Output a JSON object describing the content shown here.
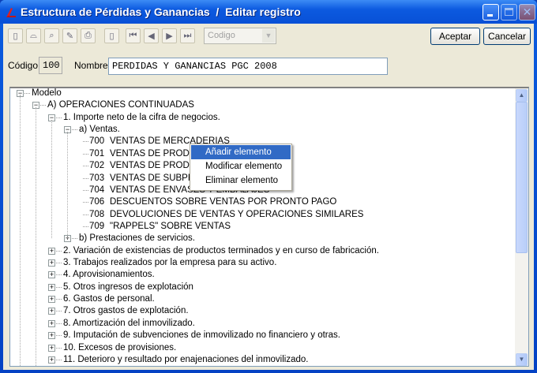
{
  "window": {
    "title": "Estructura de Pérdidas y Ganancias  /  Editar registro"
  },
  "toolbar": {
    "icons": [
      "new-icon",
      "open-icon",
      "search-icon",
      "edit-icon",
      "print-icon",
      "copy-icon",
      "first-icon",
      "prev-icon",
      "next-icon",
      "last-icon"
    ],
    "order_combo": "Codigo",
    "accept_label": "Aceptar",
    "cancel_label": "Cancelar"
  },
  "form": {
    "codigo_label": "Código",
    "codigo_value": "100",
    "nombre_label": "Nombre",
    "nombre_value": "PERDIDAS Y GANANCIAS PGC 2008"
  },
  "tree": [
    {
      "level": 0,
      "toggle": "-",
      "label": "Modelo"
    },
    {
      "level": 1,
      "toggle": "-",
      "label": "A) OPERACIONES CONTINUADAS"
    },
    {
      "level": 2,
      "toggle": "-",
      "label": "1. Importe neto de la cifra de negocios."
    },
    {
      "level": 3,
      "toggle": "-",
      "label": "a) Ventas."
    },
    {
      "level": 4,
      "code": "700",
      "label": "VENTAS DE MERCADERIAS"
    },
    {
      "level": 4,
      "code": "701",
      "label": "VENTAS DE PRODU"
    },
    {
      "level": 4,
      "code": "702",
      "label": "VENTAS DE PRODU"
    },
    {
      "level": 4,
      "code": "703",
      "label": "VENTAS DE SUBPRO"
    },
    {
      "level": 4,
      "code": "704",
      "label": "VENTAS DE ENVASES Y EMBALAJES"
    },
    {
      "level": 4,
      "code": "706",
      "label": "DESCUENTOS SOBRE VENTAS POR PRONTO PAGO"
    },
    {
      "level": 4,
      "code": "708",
      "label": "DEVOLUCIONES DE VENTAS Y OPERACIONES SIMILARES"
    },
    {
      "level": 4,
      "code": "709",
      "label": "\"RAPPELS\" SOBRE VENTAS"
    },
    {
      "level": 3,
      "toggle": "+",
      "label": "b) Prestaciones de servicios."
    },
    {
      "level": 2,
      "toggle": "+",
      "label": "2. Variación de existencias de productos terminados y en curso de fabricación."
    },
    {
      "level": 2,
      "toggle": "+",
      "label": "3. Trabajos realizados por la empresa para su activo."
    },
    {
      "level": 2,
      "toggle": "+",
      "label": "4. Aprovisionamientos."
    },
    {
      "level": 2,
      "toggle": "+",
      "label": "5. Otros ingresos de explotación"
    },
    {
      "level": 2,
      "toggle": "+",
      "label": "6. Gastos de personal."
    },
    {
      "level": 2,
      "toggle": "+",
      "label": "7. Otros gastos de explotación."
    },
    {
      "level": 2,
      "toggle": "+",
      "label": "8. Amortización del inmovilizado."
    },
    {
      "level": 2,
      "toggle": "+",
      "label": "9. Imputación de subvenciones de inmovilizado no financiero y otras."
    },
    {
      "level": 2,
      "toggle": "+",
      "label": "10. Excesos de provisiones."
    },
    {
      "level": 2,
      "toggle": "+",
      "label": "11. Deterioro y resultado por enajenaciones del inmovilizado."
    }
  ],
  "context_menu": {
    "items": [
      "Añadir elemento",
      "Modificar elemento",
      "Eliminar elemento"
    ],
    "selected": 0
  },
  "colors": {
    "title": "#0a5ce0",
    "selection": "#316ac5",
    "face": "#ece9d8"
  }
}
